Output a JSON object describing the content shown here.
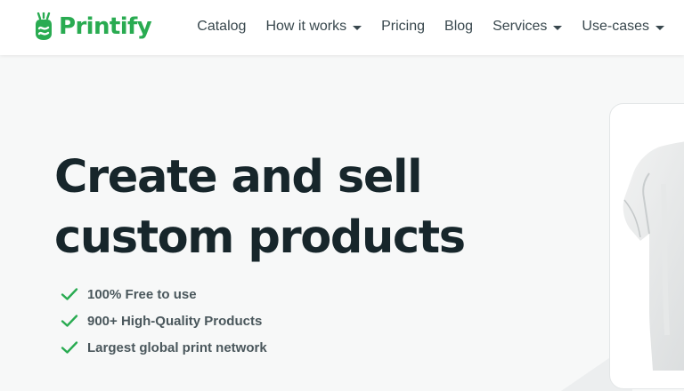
{
  "brand": {
    "name": "Printify",
    "color": "#29ab51"
  },
  "nav": {
    "items": [
      {
        "label": "Catalog",
        "dropdown": false
      },
      {
        "label": "How it works",
        "dropdown": true
      },
      {
        "label": "Pricing",
        "dropdown": false
      },
      {
        "label": "Blog",
        "dropdown": false
      },
      {
        "label": "Services",
        "dropdown": true
      },
      {
        "label": "Use-cases",
        "dropdown": true
      }
    ]
  },
  "hero": {
    "title_line1": "Create and sell",
    "title_line2": "custom products",
    "features": [
      "100% Free to use",
      "900+ High-Quality Products",
      "Largest global print network"
    ],
    "check_color": "#29ab51"
  },
  "product": {
    "icon": "white-tshirt-image"
  }
}
